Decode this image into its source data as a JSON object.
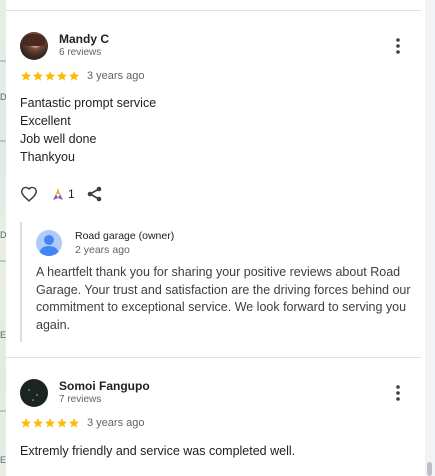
{
  "map": {
    "letters": [
      "D",
      "D",
      "E",
      "E"
    ]
  },
  "reviews": [
    {
      "author": "Mandy C",
      "review_count": "6 reviews",
      "rating": 5,
      "date": "3 years ago",
      "text_lines": [
        "Fantastic prompt service",
        "Excellent",
        "Job well done",
        "Thankyou"
      ],
      "like_count": "1",
      "owner_reply": {
        "name": "Road garage (owner)",
        "date": "2 years ago",
        "text": "A heartfelt thank you for sharing your positive reviews about Road Garage. Your trust and satisfaction are the driving forces behind our commitment to exceptional service. We look forward to serving you again."
      }
    },
    {
      "author": "Somoi Fangupo",
      "review_count": "7 reviews",
      "rating": 5,
      "date": "3 years ago",
      "text_lines": [
        "Extremly friendly and service was completed well."
      ]
    }
  ],
  "icons": {
    "more": "more-vert-icon",
    "like": "heart-icon",
    "reaction": "thumbs-up-icon",
    "share": "share-icon",
    "owner": "person-icon"
  },
  "colors": {
    "star": "#fbbc04",
    "owner_avatar": "#aecbfa",
    "owner_person": "#4285f4",
    "reaction_a": "#f9ab00",
    "reaction_b": "#7e57c2"
  }
}
